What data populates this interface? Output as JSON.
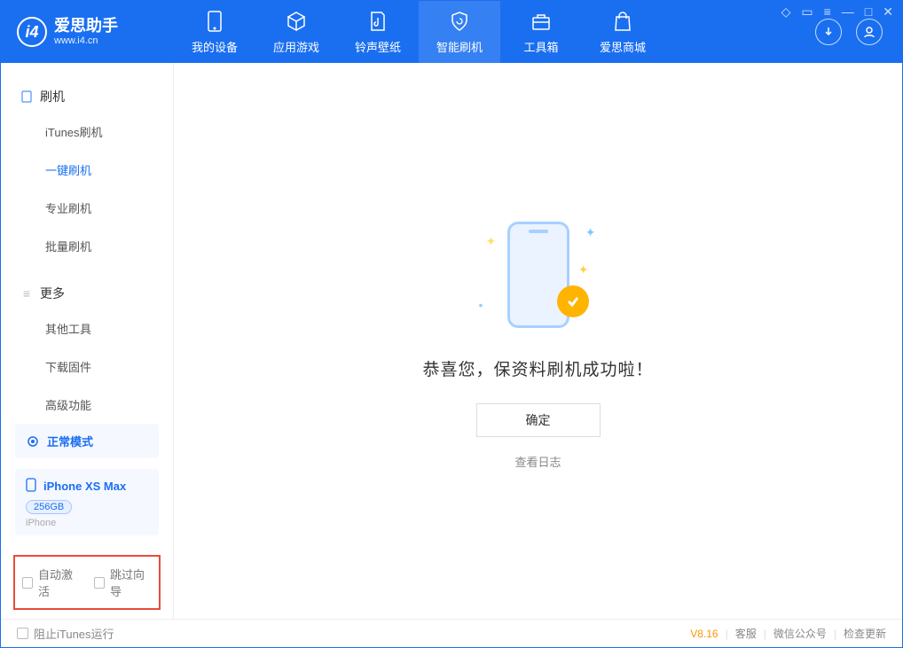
{
  "app": {
    "name": "爱思助手",
    "domain": "www.i4.cn"
  },
  "titlebar": {
    "shirt_icon": "◇",
    "book_icon": "▭",
    "list_icon": "≡",
    "minimize": "—",
    "maximize": "□",
    "close": "✕"
  },
  "tabs": [
    {
      "label": "我的设备"
    },
    {
      "label": "应用游戏"
    },
    {
      "label": "铃声壁纸"
    },
    {
      "label": "智能刷机"
    },
    {
      "label": "工具箱"
    },
    {
      "label": "爱思商城"
    }
  ],
  "sidebar": {
    "group1": {
      "title": "刷机",
      "items": [
        "iTunes刷机",
        "一键刷机",
        "专业刷机",
        "批量刷机"
      ]
    },
    "group2": {
      "title": "更多",
      "items": [
        "其他工具",
        "下载固件",
        "高级功能"
      ]
    },
    "mode_label": "正常模式",
    "device": {
      "name": "iPhone XS Max",
      "capacity": "256GB",
      "type": "iPhone"
    },
    "check_auto_activate": "自动激活",
    "check_skip_guide": "跳过向导"
  },
  "main": {
    "success_text": "恭喜您，保资料刷机成功啦！",
    "ok_button": "确定",
    "view_log": "查看日志"
  },
  "footer": {
    "block_itunes": "阻止iTunes运行",
    "version": "V8.16",
    "support": "客服",
    "wechat": "微信公众号",
    "check_update": "检查更新"
  }
}
